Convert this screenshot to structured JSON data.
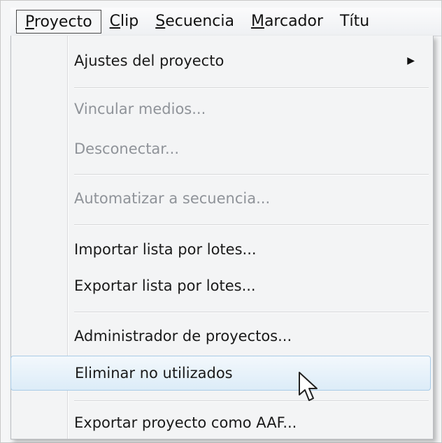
{
  "menubar": {
    "items": [
      {
        "label": "Proyecto",
        "mnemonic": "P",
        "rest": "royecto"
      },
      {
        "label": "Clip",
        "mnemonic": "C",
        "rest": "lip"
      },
      {
        "label": "Secuencia",
        "mnemonic": "S",
        "rest": "ecuencia"
      },
      {
        "label": "Marcador",
        "mnemonic": "M",
        "rest": "arcador"
      },
      {
        "label": "Títu",
        "mnemonic": "",
        "rest": "Títu"
      }
    ]
  },
  "menu": {
    "items": [
      {
        "label": "Ajustes del proyecto",
        "enabled": true,
        "submenu_icon": "submenu-arrow-icon"
      },
      {
        "label": "Vincular medios...",
        "enabled": false
      },
      {
        "label": "Desconectar...",
        "enabled": false
      },
      {
        "label": "Automatizar a secuencia...",
        "enabled": false
      },
      {
        "label": "Importar lista por lotes...",
        "enabled": true
      },
      {
        "label": "Exportar lista por lotes...",
        "enabled": true
      },
      {
        "label": "Administrador de proyectos...",
        "enabled": true
      },
      {
        "label": "Eliminar no utilizados",
        "enabled": true,
        "hovered": true
      },
      {
        "label": "Exportar proyecto como AAF...",
        "enabled": true
      }
    ]
  },
  "colors": {
    "hover_border": "#a9cbe6",
    "hover_fill": "#dcecf8",
    "disabled_text": "#8f9399"
  },
  "cursor_icon": "arrow-cursor-icon"
}
